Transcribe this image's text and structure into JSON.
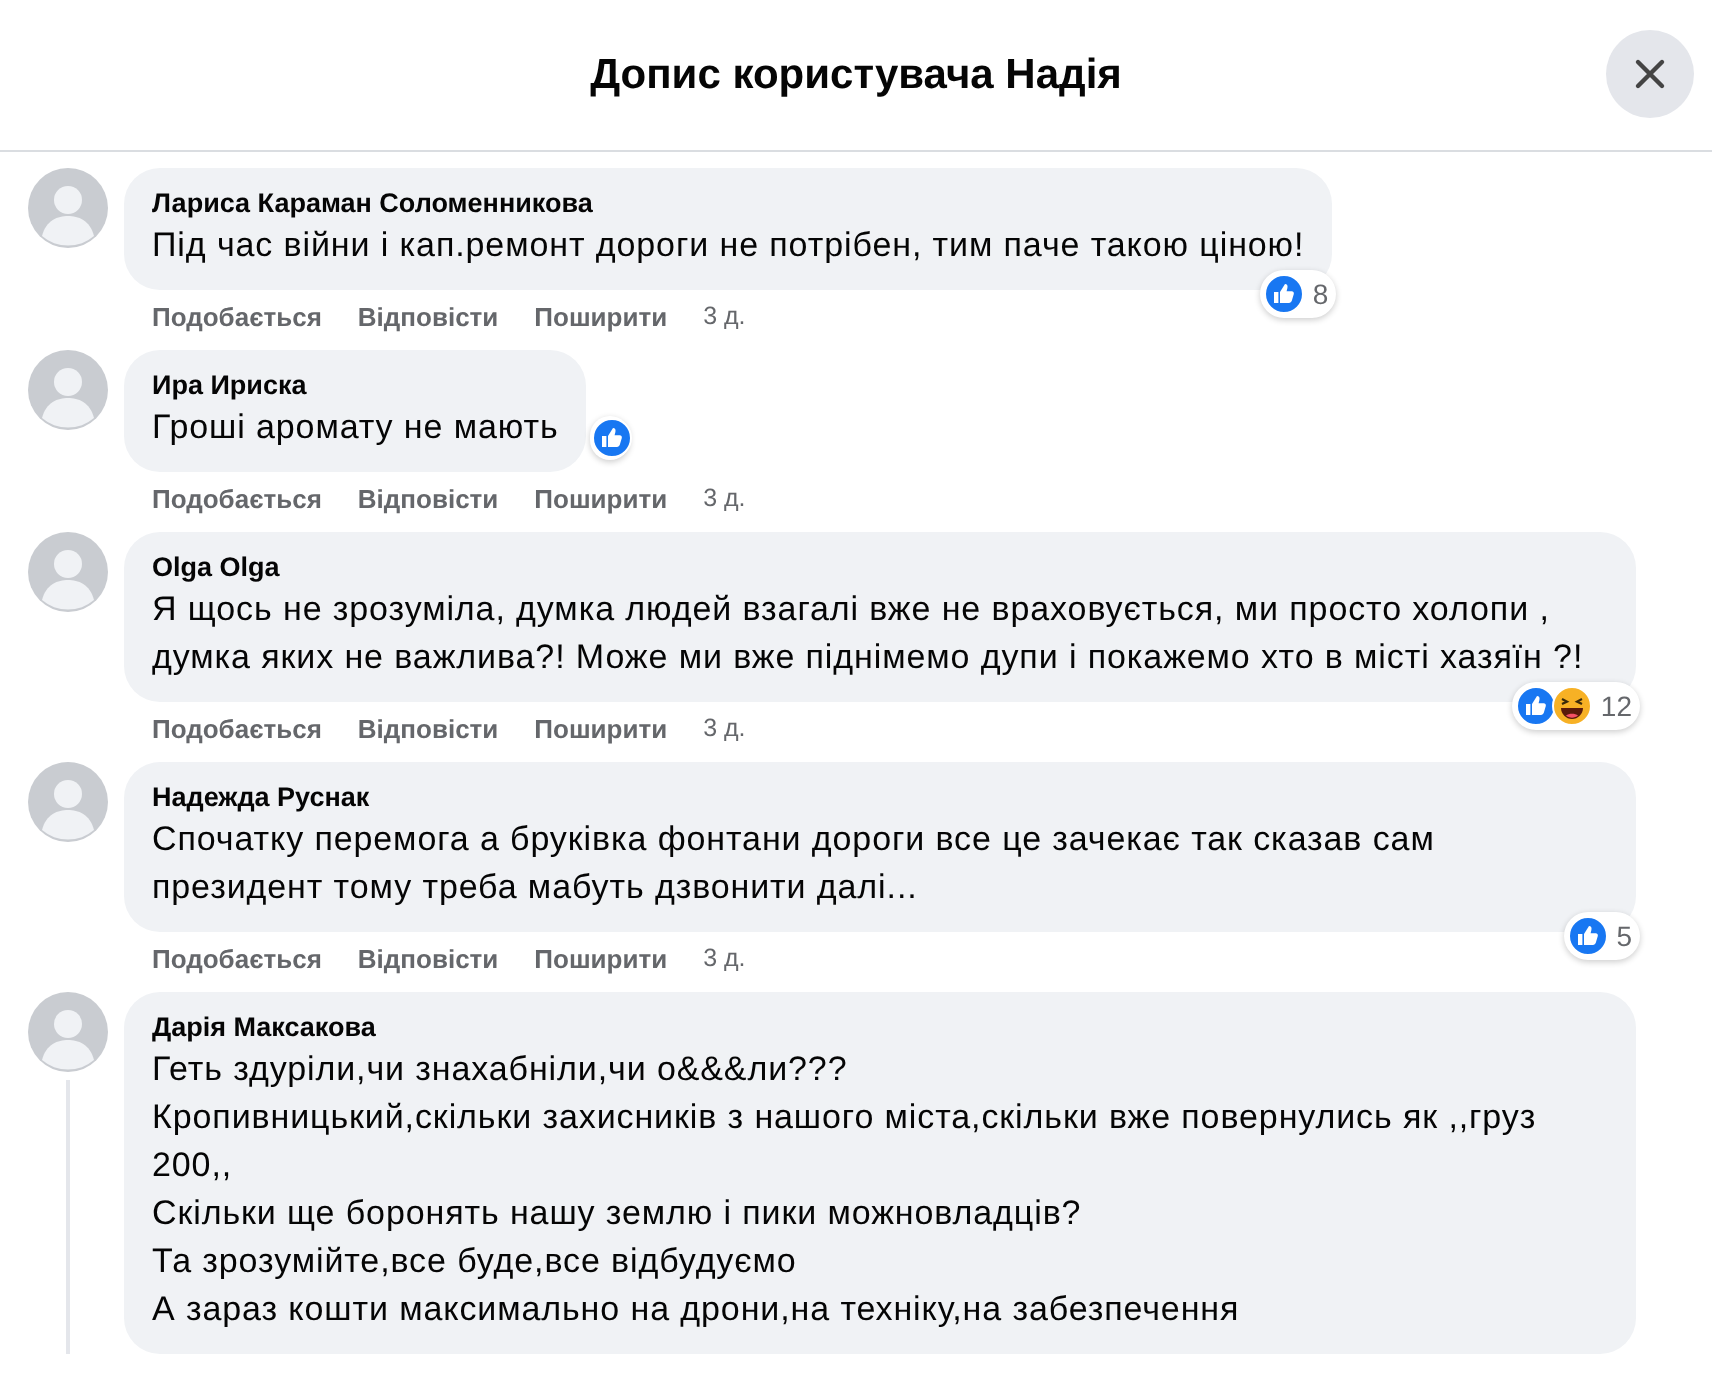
{
  "header": {
    "title": "Допис користувача Надія"
  },
  "comments": [
    {
      "author": "Лариса Караман Соломенникова",
      "paragraphs": [
        "Під час війни і кап.ремонт дороги не потрібен, тим паче такою ціною!"
      ],
      "actions": [
        "Подобається",
        "Відповісти",
        "Поширити"
      ],
      "time": "3 д.",
      "reactions": {
        "icons": [
          {
            "kind": "like"
          }
        ],
        "count": "8"
      },
      "has_replies": false
    },
    {
      "author": "Ира Ириска",
      "paragraphs": [
        "Гроші аромату не мають"
      ],
      "actions": [
        "Подобається",
        "Відповісти",
        "Поширити"
      ],
      "time": "3 д.",
      "reactions": {
        "icons": [
          {
            "kind": "like"
          }
        ]
      },
      "has_replies": false
    },
    {
      "author": "Olga Olga",
      "paragraphs": [
        "Я щось не зрозуміла, думка людей взагалі вже не враховується, ми просто холопи , думка яких не важлива?! Може ми вже піднімемо дупи і покажемо хто в місті хазяїн ?!"
      ],
      "actions": [
        "Подобається",
        "Відповісти",
        "Поширити"
      ],
      "time": "3 д.",
      "reactions": {
        "icons": [
          {
            "kind": "like"
          },
          {
            "kind": "haha"
          }
        ],
        "count": "12"
      },
      "has_replies": false
    },
    {
      "author": "Надежда Руснак",
      "paragraphs": [
        "Спочатку перемога а бруківка фонтани дороги все це зачекає так сказав сам президент тому треба мабуть дзвонити далі..."
      ],
      "actions": [
        "Подобається",
        "Відповісти",
        "Поширити"
      ],
      "time": "3 д.",
      "reactions": {
        "icons": [
          {
            "kind": "like"
          }
        ],
        "count": "5"
      },
      "has_replies": false
    },
    {
      "author": "Дарія Максакова",
      "paragraphs": [
        "Геть здуріли,чи знахабніли,чи о&&&ли???",
        "Кропивницький,скільки захисників з нашого міста,скільки вже повернулись як ,,груз 200,,",
        "Скільки ще боронять нашу землю і пики можновладців?",
        "Та зрозумійте,все буде,все відбудуємо",
        "А зараз кошти максимально на дрони,на техніку,на забезпечення"
      ],
      "has_replies": true
    }
  ]
}
